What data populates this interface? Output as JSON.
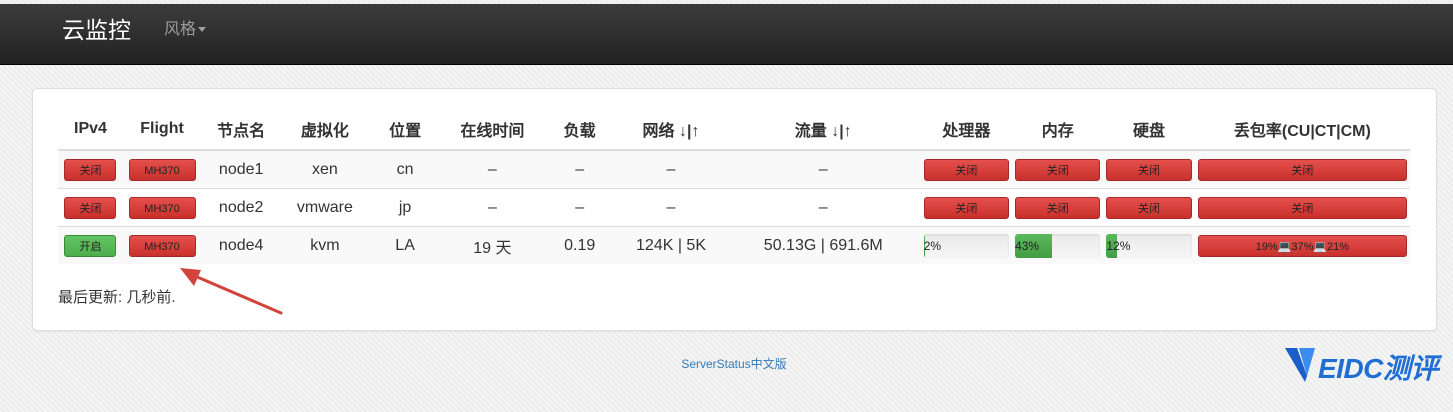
{
  "navbar": {
    "brand": "云监控",
    "style_menu": "风格"
  },
  "table": {
    "headers": [
      "IPv4",
      "Flight",
      "节点名",
      "虚拟化",
      "位置",
      "在线时间",
      "负载",
      "网络 ↓|↑",
      "流量 ↓|↑",
      "处理器",
      "内存",
      "硬盘",
      "丢包率(CU|CT|CM)"
    ],
    "rows": [
      {
        "ipv4": "关闭",
        "ipv4_on": false,
        "flight": "MH370",
        "name": "node1",
        "virt": "xen",
        "loc": "cn",
        "uptime": "–",
        "load": "–",
        "net": "–",
        "traffic": "–",
        "cpu": "关闭",
        "mem": "关闭",
        "disk": "关闭",
        "loss": "关闭"
      },
      {
        "ipv4": "关闭",
        "ipv4_on": false,
        "flight": "MH370",
        "name": "node2",
        "virt": "vmware",
        "loc": "jp",
        "uptime": "–",
        "load": "–",
        "net": "–",
        "traffic": "–",
        "cpu": "关闭",
        "mem": "关闭",
        "disk": "关闭",
        "loss": "关闭"
      },
      {
        "ipv4": "开启",
        "ipv4_on": true,
        "flight": "MH370",
        "name": "node4",
        "virt": "kvm",
        "loc": "LA",
        "uptime": "19 天",
        "load": "0.19",
        "net": "124K | 5K",
        "traffic": "50.13G | 691.6M",
        "cpu": "2%",
        "cpu_pct": 2,
        "mem": "43%",
        "mem_pct": 43,
        "disk": "12%",
        "disk_pct": 12,
        "loss": "19%💻37%💻21%"
      }
    ]
  },
  "last_update": "最后更新: 几秒前.",
  "footer": "ServerStatus中文版",
  "watermark": "EIDC测评",
  "colors": {
    "red": "#d9534f",
    "green": "#5cb85c",
    "link": "#337ab7",
    "arrow": "#d2433b"
  }
}
